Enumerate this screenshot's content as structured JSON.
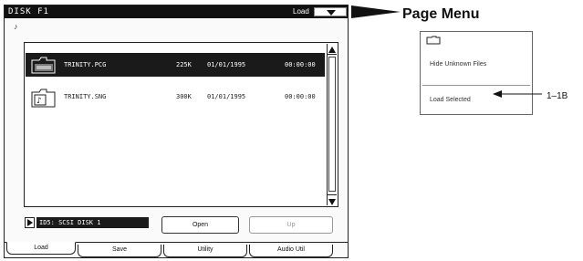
{
  "window": {
    "title": "DISK F1",
    "mode_label": "Load"
  },
  "files": [
    {
      "name": "TRINITY.PCG",
      "size": "225K",
      "date": "01/01/1995",
      "time": "00:00:00",
      "icon": "pcg-file-icon",
      "selected": true
    },
    {
      "name": "TRINITY.SNG",
      "size": "300K",
      "date": "01/01/1995",
      "time": "00:00:00",
      "icon": "song-file-icon",
      "selected": false
    }
  ],
  "drive": {
    "label": "ID5: SCSI DISK 1"
  },
  "buttons": {
    "open": "Open",
    "up": "Up"
  },
  "tabs": [
    {
      "label": "Load",
      "active": true
    },
    {
      "label": "Save",
      "active": false
    },
    {
      "label": "Utility",
      "active": false
    },
    {
      "label": "Audio Util",
      "active": false
    }
  ],
  "page_menu": {
    "heading": "Page Menu",
    "items": [
      {
        "label": "Hide Unknown Files"
      },
      {
        "label": "Load Selected"
      }
    ],
    "callout": "1–1B"
  }
}
